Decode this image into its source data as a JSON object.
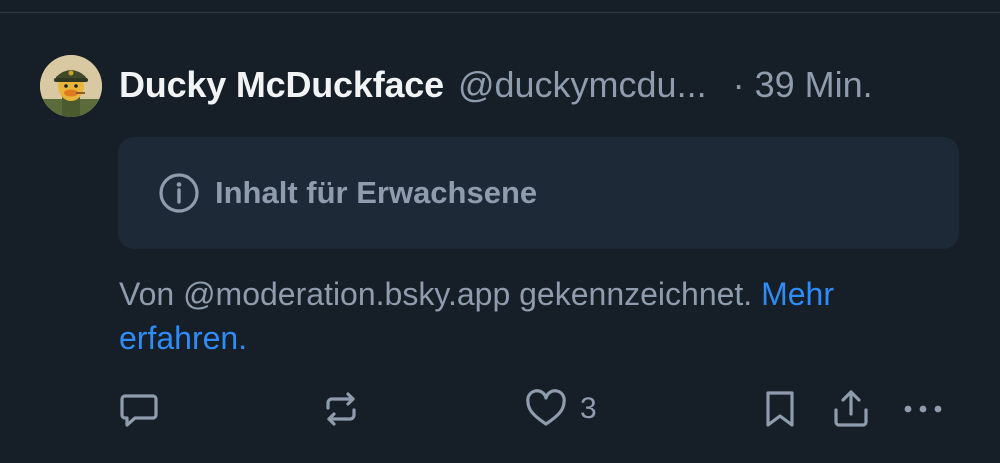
{
  "post": {
    "author": {
      "display_name": "Ducky McDuckface",
      "handle": "@duckymcdu..."
    },
    "separator": "·",
    "timestamp": "39 Min.",
    "content_warning": {
      "icon": "info-icon",
      "label": "Inhalt für Erwachsene"
    },
    "moderation_note": {
      "text": "Von @moderation.bsky.app gekennzeichnet. ",
      "link_text": "Mehr erfahren."
    },
    "actions": {
      "reply_icon": "reply-icon",
      "repost_icon": "repost-icon",
      "like_icon": "heart-icon",
      "like_count": "3",
      "bookmark_icon": "bookmark-icon",
      "share_icon": "share-icon",
      "more_icon": "more-icon"
    }
  },
  "colors": {
    "background": "#161e27",
    "warning_box": "#1e2937",
    "muted_text": "#8f9cad",
    "link": "#2f8cf5",
    "primary_text": "#f1f3f5"
  }
}
